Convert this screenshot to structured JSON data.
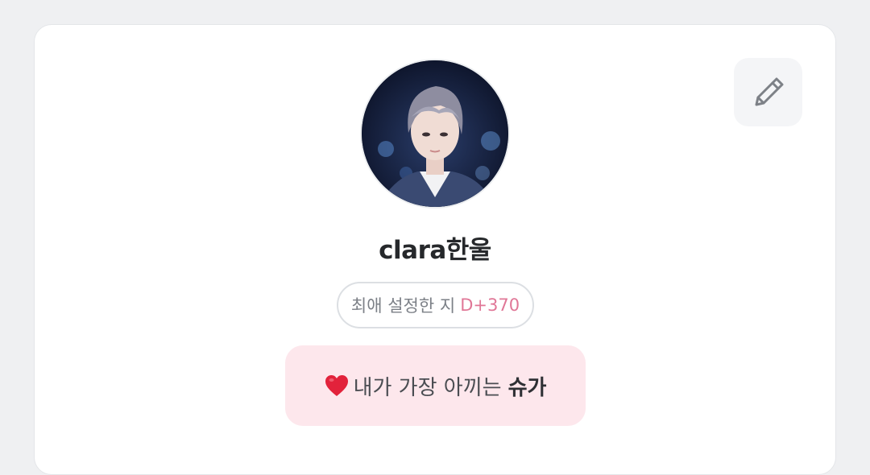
{
  "profile": {
    "username": "clara한울",
    "avatar_alt": "profile photo",
    "edit_icon": "pencil-icon"
  },
  "dday": {
    "label": "최애 설정한 지",
    "value": "D+370"
  },
  "bias": {
    "icon": "heart-icon",
    "label": "내가 가장 아끼는",
    "name": "슈가"
  },
  "colors": {
    "background": "#eff0f2",
    "card": "#ffffff",
    "accent_pink": "#e07797",
    "bias_box": "#fde7ec"
  }
}
